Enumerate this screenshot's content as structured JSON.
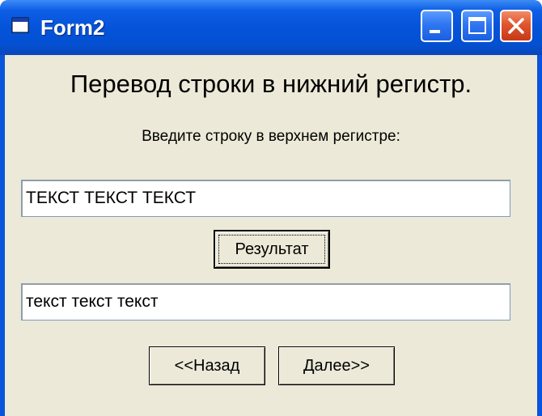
{
  "window": {
    "title": "Form2"
  },
  "form": {
    "heading": "Перевод строки в нижний регистр.",
    "prompt": "Введите строку в верхнем регистре:",
    "input_value": "ТЕКСТ ТЕКСТ ТЕКСТ",
    "result_label": "Результат",
    "output_value": "текст текст текст",
    "back_label": "<<Назад",
    "next_label": "Далее>>"
  }
}
